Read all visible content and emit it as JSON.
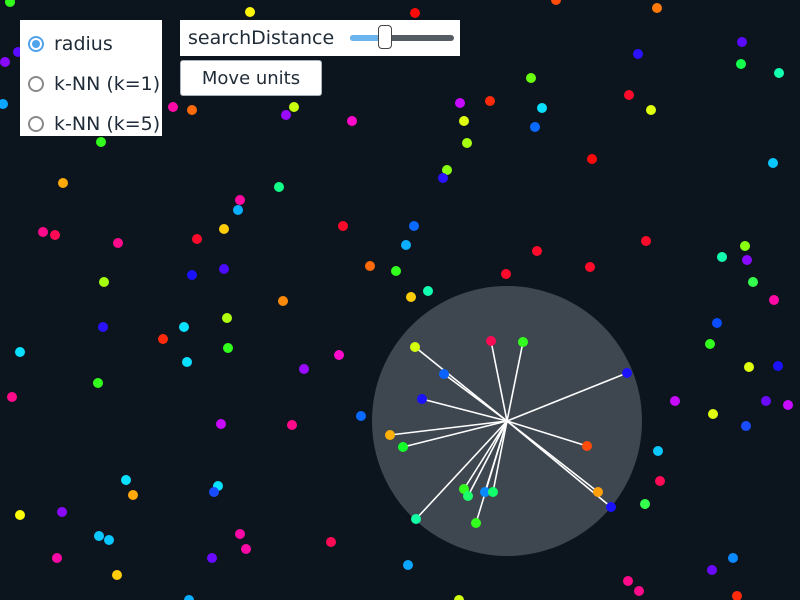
{
  "mode": {
    "options": [
      {
        "label": "radius",
        "checked": true
      },
      {
        "label": "k-NN (k=1)",
        "checked": false
      },
      {
        "label": "k-NN (k=5)",
        "checked": false
      }
    ]
  },
  "slider": {
    "label": "searchDistance",
    "value_fraction": 0.33
  },
  "move_button": {
    "label": "Move units"
  },
  "scene": {
    "background": "#0c151d",
    "search_area_color": "#3e4750",
    "link_color": "#ffffff",
    "query_unit_index": 0
  },
  "units": [
    [
      507,
      421,
      "#ffffff"
    ],
    [
      491,
      341,
      "#ff0a55"
    ],
    [
      523,
      342,
      "#33ff1e"
    ],
    [
      415,
      347,
      "#d4ff0e"
    ],
    [
      444,
      374,
      "#0a63ff"
    ],
    [
      627,
      373,
      "#1a12ff"
    ],
    [
      422,
      399,
      "#1a12ff"
    ],
    [
      390,
      435,
      "#ffb10a"
    ],
    [
      403,
      447,
      "#12ff2a"
    ],
    [
      587,
      446,
      "#ff4c0a"
    ],
    [
      598,
      492,
      "#ff9f0a"
    ],
    [
      611,
      507,
      "#1a12ff"
    ],
    [
      416,
      519,
      "#12ffa6"
    ],
    [
      464,
      489,
      "#33ff1e"
    ],
    [
      468,
      496,
      "#1dff6b"
    ],
    [
      485,
      492,
      "#0a8aff"
    ],
    [
      493,
      492,
      "#12ff6b"
    ],
    [
      476,
      523,
      "#33ff1e"
    ],
    [
      250,
      12,
      "#fff50a"
    ],
    [
      415,
      13,
      "#ff0a0a"
    ],
    [
      556,
      0,
      "#ff4c0a"
    ],
    [
      657,
      8,
      "#ff7a0a"
    ],
    [
      10,
      2,
      "#33ff1e"
    ],
    [
      18,
      52,
      "#5a0aff"
    ],
    [
      5,
      62,
      "#8a0aff"
    ],
    [
      3,
      104,
      "#0aa6ff"
    ],
    [
      173,
      107,
      "#ff0aa6"
    ],
    [
      192,
      110,
      "#ff6a0a"
    ],
    [
      286,
      115,
      "#9a0aff"
    ],
    [
      294,
      107,
      "#c8ff0e"
    ],
    [
      352,
      121,
      "#ff0aca"
    ],
    [
      460,
      103,
      "#c80aff"
    ],
    [
      490,
      101,
      "#ff2a0a"
    ],
    [
      531,
      78,
      "#6aff0e"
    ],
    [
      542,
      108,
      "#0ae0ff"
    ],
    [
      535,
      127,
      "#0a6aff"
    ],
    [
      464,
      121,
      "#e0ff0e"
    ],
    [
      467,
      143,
      "#a6ff0e"
    ],
    [
      447,
      170,
      "#8aff0e"
    ],
    [
      443,
      178,
      "#2a12ff"
    ],
    [
      101,
      142,
      "#33ff1e"
    ],
    [
      63,
      183,
      "#ffaa0a"
    ],
    [
      638,
      54,
      "#2a12ff"
    ],
    [
      742,
      42,
      "#5a0aff"
    ],
    [
      741,
      64,
      "#12ff4c"
    ],
    [
      779,
      73,
      "#12ffb0"
    ],
    [
      629,
      95,
      "#ff0a2a"
    ],
    [
      651,
      110,
      "#e0ff0e"
    ],
    [
      592,
      159,
      "#ff0a0a"
    ],
    [
      773,
      163,
      "#0ac8ff"
    ],
    [
      279,
      187,
      "#12ff8a"
    ],
    [
      240,
      200,
      "#ff0aa0"
    ],
    [
      238,
      210,
      "#0ab0ff"
    ],
    [
      43,
      232,
      "#ff0a8a"
    ],
    [
      55,
      235,
      "#ff0a55"
    ],
    [
      118,
      243,
      "#ff0a8a"
    ],
    [
      197,
      239,
      "#ff0a2a"
    ],
    [
      224,
      229,
      "#ffcc0a"
    ],
    [
      343,
      226,
      "#ff0a2a"
    ],
    [
      414,
      226,
      "#0a6aff"
    ],
    [
      406,
      245,
      "#0ab0ff"
    ],
    [
      537,
      251,
      "#ff0a2a"
    ],
    [
      646,
      241,
      "#ff0a2a"
    ],
    [
      745,
      246,
      "#8aff0e"
    ],
    [
      747,
      260,
      "#8a0aff"
    ],
    [
      722,
      257,
      "#12ffb0"
    ],
    [
      753,
      282,
      "#33ff4c"
    ],
    [
      370,
      266,
      "#ff6a0a"
    ],
    [
      396,
      271,
      "#33ff1e"
    ],
    [
      506,
      274,
      "#ff0a2a"
    ],
    [
      590,
      267,
      "#ff0a2a"
    ],
    [
      192,
      275,
      "#1a12ff"
    ],
    [
      224,
      269,
      "#4c0aff"
    ],
    [
      104,
      282,
      "#a6ff0e"
    ],
    [
      283,
      301,
      "#ff8a0a"
    ],
    [
      411,
      297,
      "#ffcc0a"
    ],
    [
      428,
      291,
      "#12ffb0"
    ],
    [
      774,
      300,
      "#ff0aa6"
    ],
    [
      717,
      323,
      "#0a4cff"
    ],
    [
      103,
      327,
      "#2a12ff"
    ],
    [
      184,
      327,
      "#0ae0ff"
    ],
    [
      227,
      318,
      "#b0ff0e"
    ],
    [
      163,
      339,
      "#ff2a0a"
    ],
    [
      228,
      348,
      "#33ff1e"
    ],
    [
      710,
      344,
      "#33ff1e"
    ],
    [
      20,
      352,
      "#0ae0ff"
    ],
    [
      187,
      362,
      "#0ae0ff"
    ],
    [
      339,
      355,
      "#ff0acc"
    ],
    [
      304,
      369,
      "#9a0aff"
    ],
    [
      749,
      367,
      "#e0ff0e"
    ],
    [
      778,
      366,
      "#1a12ff"
    ],
    [
      98,
      383,
      "#33ff1e"
    ],
    [
      12,
      397,
      "#ff0a8a"
    ],
    [
      675,
      401,
      "#c80aff"
    ],
    [
      766,
      401,
      "#6a0aff"
    ],
    [
      788,
      405,
      "#c80aff"
    ],
    [
      361,
      416,
      "#0a6aff"
    ],
    [
      713,
      414,
      "#e0ff0e"
    ],
    [
      221,
      424,
      "#c80aff"
    ],
    [
      292,
      425,
      "#ff0a8a"
    ],
    [
      746,
      426,
      "#1a4cff"
    ],
    [
      658,
      451,
      "#0ac8ff"
    ],
    [
      660,
      481,
      "#ff0a55"
    ],
    [
      126,
      480,
      "#0ae0ff"
    ],
    [
      133,
      495,
      "#ffaa0a"
    ],
    [
      218,
      486,
      "#0ae0ff"
    ],
    [
      214,
      492,
      "#1a4cff"
    ],
    [
      645,
      504,
      "#33ff4c"
    ],
    [
      20,
      515,
      "#ffff0a"
    ],
    [
      62,
      512,
      "#8a0aff"
    ],
    [
      99,
      536,
      "#0ac8ff"
    ],
    [
      109,
      540,
      "#0ac8ff"
    ],
    [
      240,
      534,
      "#ff0aa6"
    ],
    [
      246,
      549,
      "#ff0aa6"
    ],
    [
      331,
      542,
      "#ff0a55"
    ],
    [
      212,
      558,
      "#6a0aff"
    ],
    [
      57,
      558,
      "#ff0aa6"
    ],
    [
      117,
      575,
      "#ffcc0a"
    ],
    [
      408,
      565,
      "#0aa6ff"
    ],
    [
      733,
      558,
      "#0a8aff"
    ],
    [
      712,
      570,
      "#6a0aff"
    ],
    [
      628,
      581,
      "#ff0a8a"
    ],
    [
      639,
      591,
      "#ff0a8a"
    ],
    [
      737,
      596,
      "#ff2a0a"
    ],
    [
      459,
      600,
      "#d4ff0e"
    ],
    [
      189,
      600,
      "#0ab0ff"
    ]
  ]
}
